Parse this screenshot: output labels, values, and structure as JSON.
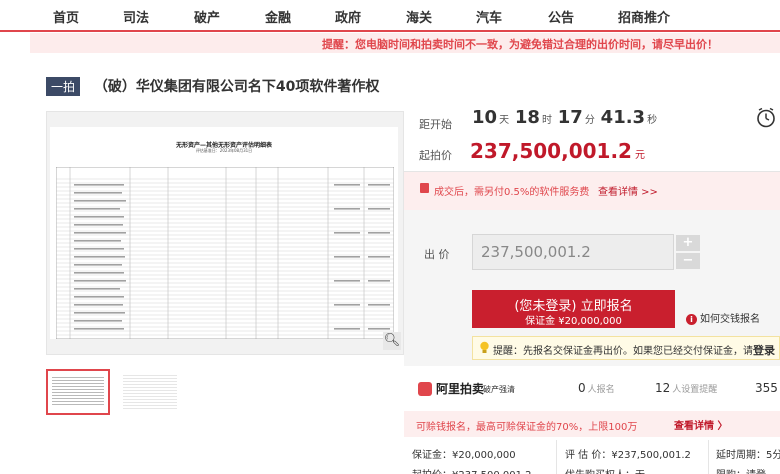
{
  "nav": {
    "items": [
      "首页",
      "司法",
      "破产",
      "金融",
      "政府",
      "海关",
      "汽车",
      "公告",
      "招商推介"
    ]
  },
  "notice": {
    "text": "提醒：您电脑时间和拍卖时间不一致，为避免错过合理的出价时间，请尽早出价！"
  },
  "item": {
    "round_tag": "一拍",
    "title": "（破）华仪集团有限公司名下40项软件著作权"
  },
  "document": {
    "title": "无形资产—其他无形资产评估明细表",
    "subtitle": "评估基准日：2023年08月31日"
  },
  "countdown": {
    "label": "距开始",
    "days": "10",
    "days_unit": "天",
    "hours": "18",
    "hours_unit": "时",
    "minutes": "17",
    "minutes_unit": "分",
    "seconds": "41.3",
    "seconds_unit": "秒"
  },
  "start_price": {
    "label": "起拍价",
    "value": "237,500,001.2",
    "unit": "元"
  },
  "fee": {
    "text": "成交后，需另付0.5%的软件服务费",
    "link": "查看详情 >>"
  },
  "bid": {
    "label": "出 价",
    "value": "237,500,001.2",
    "plus": "+",
    "minus": "−"
  },
  "signup": {
    "main": "(您未登录) 立即报名",
    "deposit": "保证金 ¥20,000,000"
  },
  "how_pay": {
    "label": "如何交钱报名"
  },
  "tip": {
    "text": "提醒：先报名交保证金再出价。如果您已经交付保证金，请",
    "link": "登录"
  },
  "brand": {
    "name": "阿里拍卖",
    "sub": "破产强清"
  },
  "stats": {
    "signups": {
      "value": "0",
      "label": "人报名"
    },
    "reminders": {
      "value": "12",
      "label": "人设置提醒"
    },
    "views": {
      "value": "355"
    }
  },
  "loan": {
    "text": "可赊钱报名，最高可赊保证金的70%，上限100万",
    "link": "查看详情 〉"
  },
  "details": {
    "deposit": "保证金：¥20,000,000",
    "valuation": "评 估 价：¥237,500,001.2",
    "delay": "延时周期：5分",
    "start_price_partial": "起拍价：¥237,500,001.2",
    "priority_partial": "优先购买权人：无",
    "restriction_partial": "限购：请登"
  },
  "colors": {
    "accent": "#c91f2e",
    "notice_bg": "#fdecec",
    "tag_bg": "#3c4a66"
  }
}
